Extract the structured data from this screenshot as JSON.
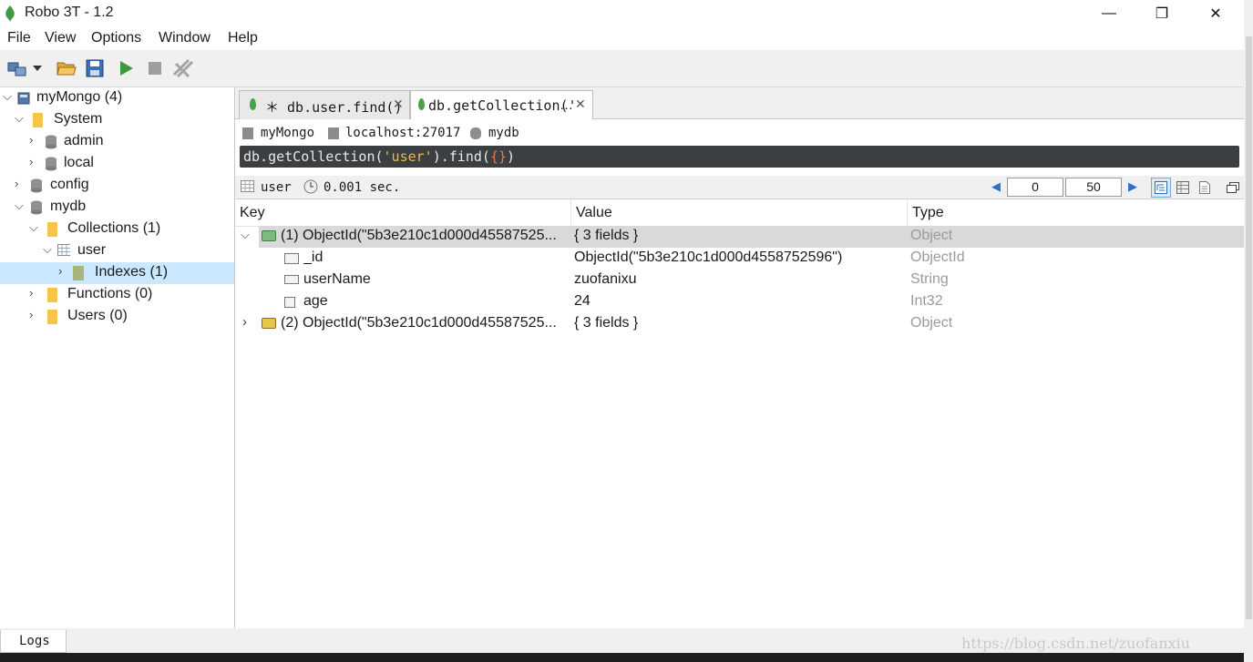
{
  "window": {
    "title": "Robo 3T - 1.2",
    "min": "—",
    "max": "❐",
    "close": "✕"
  },
  "menu": [
    "File",
    "View",
    "Options",
    "Window",
    "Help"
  ],
  "tree": {
    "server": "myMongo (4)",
    "system": "System",
    "admin": "admin",
    "local": "local",
    "config": "config",
    "mydb": "mydb",
    "collections": "Collections (1)",
    "user": "user",
    "indexes": "Indexes (1)",
    "functions": "Functions (0)",
    "users": "Users (0)"
  },
  "tabs": [
    {
      "label": "＊ db.user.find()",
      "close": "✕"
    },
    {
      "label": "db.getCollection('",
      "ellipsis": "…",
      "close": "✕"
    }
  ],
  "connection": {
    "server": "myMongo",
    "host": "localhost:27017",
    "db": "mydb"
  },
  "query": {
    "prefix": "db.getCollection(",
    "string": "'user'",
    "mid": ").find(",
    "braces": "{}",
    "suffix": ")"
  },
  "result_bar": {
    "collection": "user",
    "time": "0.001 sec.",
    "skip": "0",
    "limit": "50"
  },
  "table": {
    "headers": {
      "key": "Key",
      "value": "Value",
      "type": "Type"
    },
    "rows": [
      {
        "key": "(1) ObjectId(\"5b3e210c1d000d45587525...",
        "value": "{ 3 fields }",
        "type": "Object"
      },
      {
        "key": "_id",
        "value": "ObjectId(\"5b3e210c1d000d4558752596\")",
        "type": "ObjectId"
      },
      {
        "key": "userName",
        "value": "zuofanixu",
        "type": "String"
      },
      {
        "key": "age",
        "value": "24",
        "type": "Int32"
      },
      {
        "key": "(2) ObjectId(\"5b3e210c1d000d45587525...",
        "value": "{ 3 fields }",
        "type": "Object"
      }
    ]
  },
  "logs": "Logs",
  "watermark": "https://blog.csdn.net/zuofanxiu",
  "colors": {
    "query_bg": "#3c3f41",
    "selection": "#cce8ff",
    "leaf": "#4aa14a",
    "folder": "#f6c64c"
  }
}
